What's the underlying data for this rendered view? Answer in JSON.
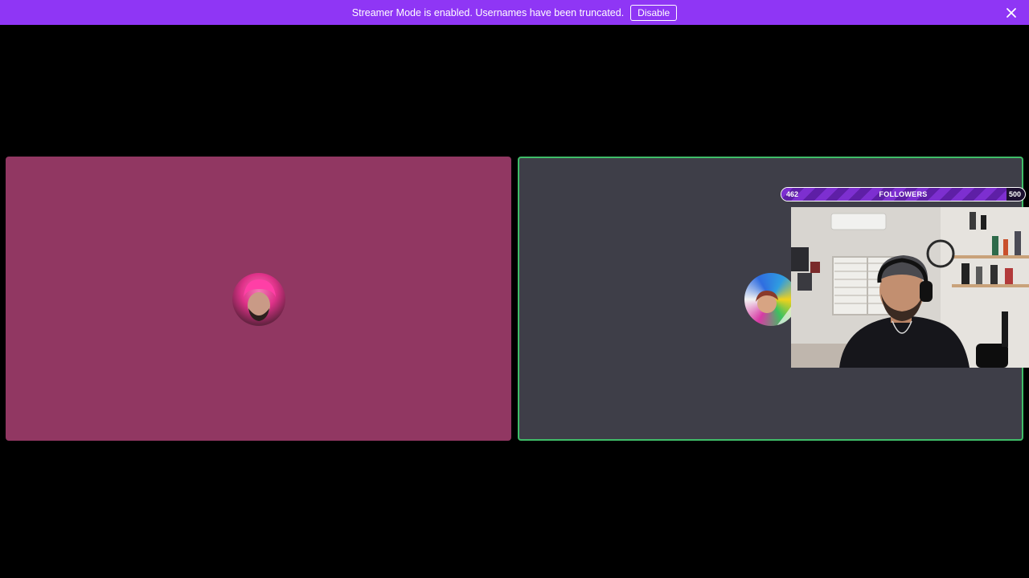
{
  "banner": {
    "message": "Streamer Mode is enabled. Usernames have been truncated.",
    "disable_label": "Disable",
    "close_icon": "close-icon"
  },
  "tiles": [
    {
      "id": "left",
      "avatar_icon": "user-avatar",
      "bg": "#913762"
    },
    {
      "id": "right",
      "avatar_icon": "user-avatar",
      "bg": "#3e3e48",
      "speaking_border": "#3fbd68"
    }
  ],
  "followers_goal": {
    "label": "FOLLOWERS",
    "current": "462",
    "goal": "500",
    "progress_fraction": 0.924
  },
  "colors": {
    "banner_bg": "#8f36f5",
    "page_bg": "#000000"
  }
}
